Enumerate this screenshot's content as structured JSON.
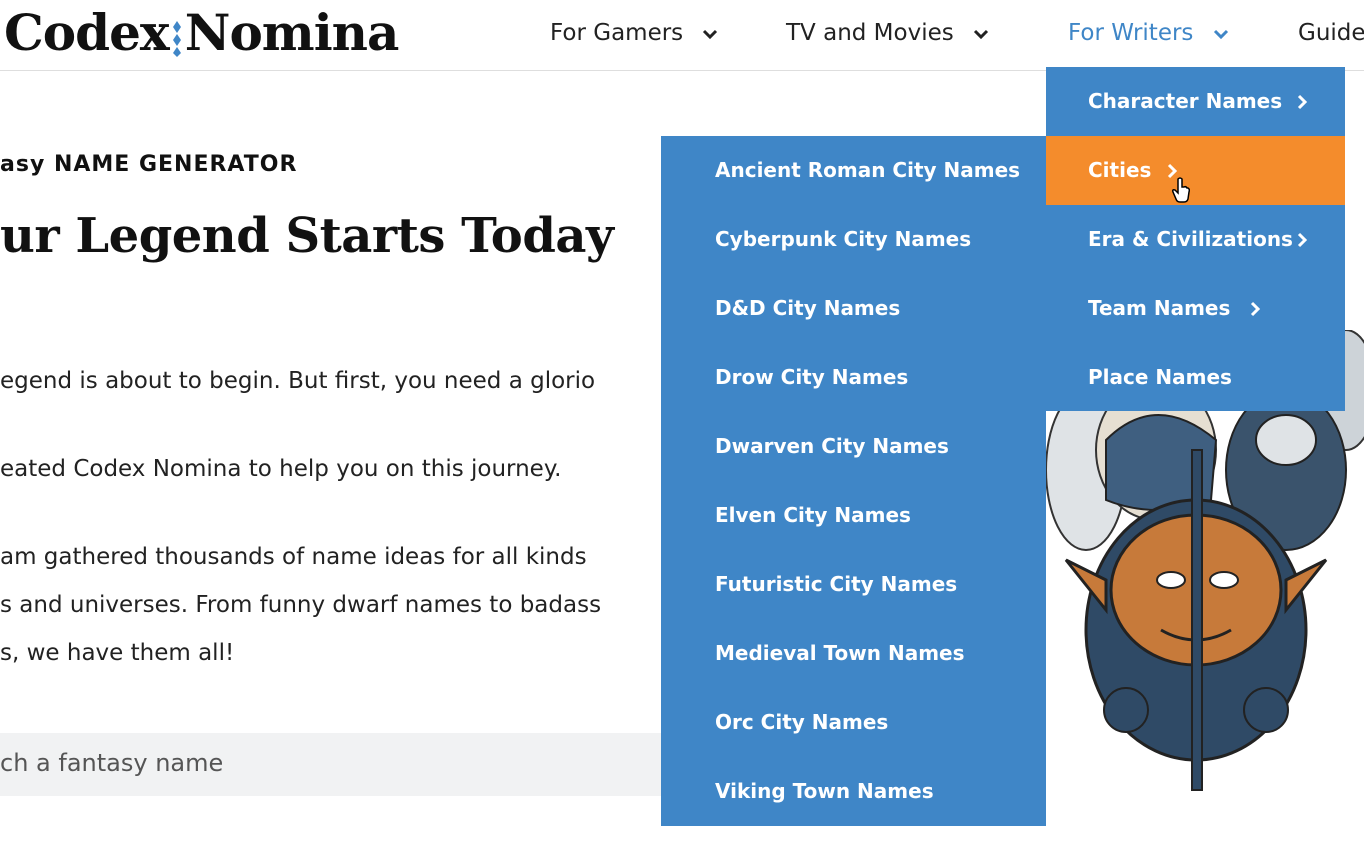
{
  "header": {
    "logo": "Codex Nomina",
    "nav": [
      {
        "label": "For Gamers"
      },
      {
        "label": "TV and Movies"
      },
      {
        "label": "For Writers"
      },
      {
        "label": "Guide"
      }
    ]
  },
  "hero": {
    "eyebrow": "asy NAME GENERATOR",
    "title": "ur Legend Starts Today",
    "paragraphs": [
      "egend is about to begin. But first, you need a glorio",
      "eated Codex Nomina to help you on this journey.",
      "am gathered thousands of name ideas for all kinds",
      "s and universes. From funny dwarf names to badass",
      "s, we have them all!"
    ],
    "search_placeholder": "ch a fantasy name"
  },
  "dropdown": {
    "items": [
      {
        "label": "Character Names",
        "icon": "chevron-right-icon"
      },
      {
        "label": "Cities",
        "icon": "chevron-right-icon"
      },
      {
        "label": "Era & Civilizations",
        "icon": "chevron-right-icon"
      },
      {
        "label": "Team Names",
        "icon": "chevron-right-icon"
      },
      {
        "label": "Place Names"
      }
    ]
  },
  "submenu": {
    "items": [
      {
        "label": "Ancient Roman City Names"
      },
      {
        "label": "Cyberpunk City Names"
      },
      {
        "label": "D&D City Names"
      },
      {
        "label": "Drow City Names"
      },
      {
        "label": "Dwarven City Names"
      },
      {
        "label": "Elven City Names"
      },
      {
        "label": "Futuristic City Names"
      },
      {
        "label": "Medieval Town Names"
      },
      {
        "label": "Orc City Names"
      },
      {
        "label": "Viking Town Names"
      }
    ]
  },
  "colors": {
    "menu_blue": "#3f86c7",
    "highlight_orange": "#f48c2c",
    "active_nav": "#3f86c7"
  }
}
